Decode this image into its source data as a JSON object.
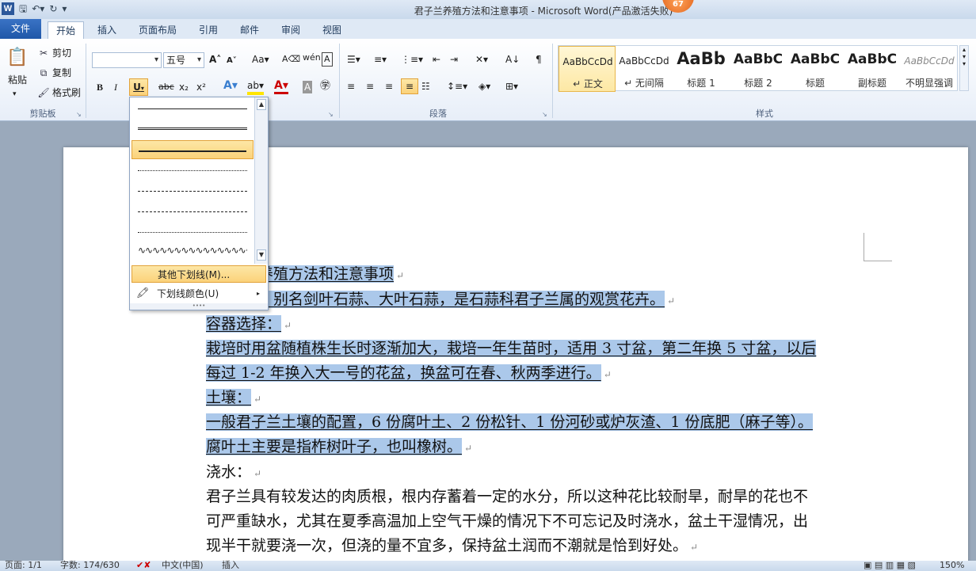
{
  "window": {
    "title": "君子兰养殖方法和注意事项  -  Microsoft Word(产品激活失败)",
    "app_icon": "W",
    "badge": "67"
  },
  "tabs": [
    "文件",
    "开始",
    "插入",
    "页面布局",
    "引用",
    "邮件",
    "审阅",
    "视图"
  ],
  "active_tab": "开始",
  "clipboard": {
    "paste": "粘贴",
    "cut": "剪切",
    "copy": "复制",
    "format_painter": "格式刷",
    "group": "剪贴板"
  },
  "font": {
    "size": "五号",
    "group": ""
  },
  "paragraph": {
    "group": "段落"
  },
  "styles": {
    "group": "样式",
    "items": [
      {
        "sample": "AaBbCcDd",
        "name": "↵ 正文"
      },
      {
        "sample": "AaBbCcDd",
        "name": "↵ 无间隔"
      },
      {
        "sample": "AaBb",
        "name": "标题 1"
      },
      {
        "sample": "AaBbC",
        "name": "标题 2"
      },
      {
        "sample": "AaBbC",
        "name": "标题"
      },
      {
        "sample": "AaBbC",
        "name": "副标题"
      },
      {
        "sample": "AaBbCcDd",
        "name": "不明显强调"
      }
    ]
  },
  "underline_menu": {
    "more": "其他下划线(M)...",
    "color": "下划线颜色(U)"
  },
  "document": {
    "lines": [
      {
        "text": "养殖方法和注意事项",
        "hl": true
      },
      {
        "text": "，别名剑叶石蒜、大叶石蒜，是石蒜科君子兰属的观赏花卉。",
        "hl": true
      },
      {
        "text": "容器选择：",
        "hl": true
      },
      {
        "text": "栽培时用盆随植株生长时逐渐加大，栽培一年生苗时，适用 3 寸盆，第二年换 5 寸盆，以后",
        "hl": true
      },
      {
        "text": "每过 1-2 年换入大一号的花盆，换盆可在春、秋两季进行。",
        "hl": true
      },
      {
        "text": "土壤：",
        "hl": true
      },
      {
        "text": "一般君子兰土壤的配置，6 份腐叶土、2 份松针、1 份河砂或炉灰渣、1 份底肥（麻子等）。",
        "hl": true
      },
      {
        "text": "腐叶土主要是指柞树叶子，也叫橡树。",
        "hl": true
      },
      {
        "text": "浇水：",
        "hl": false
      },
      {
        "text": "君子兰具有较发达的肉质根，根内存蓄着一定的水分，所以这种花比较耐旱，耐旱的花也不",
        "hl": false
      },
      {
        "text": "可严重缺水，尤其在夏季高温加上空气干燥的情况下不可忘记及时浇水，盆土干湿情况，出",
        "hl": false
      },
      {
        "text": "现半干就要浇一次，但浇的量不宜多，保持盆土润而不潮就是恰到好处。",
        "hl": false
      }
    ]
  },
  "status": {
    "page": "页面: 1/1",
    "words": "字数: 174/630",
    "lang": "中文(中国)",
    "mode": "插入",
    "zoom": "150%"
  }
}
